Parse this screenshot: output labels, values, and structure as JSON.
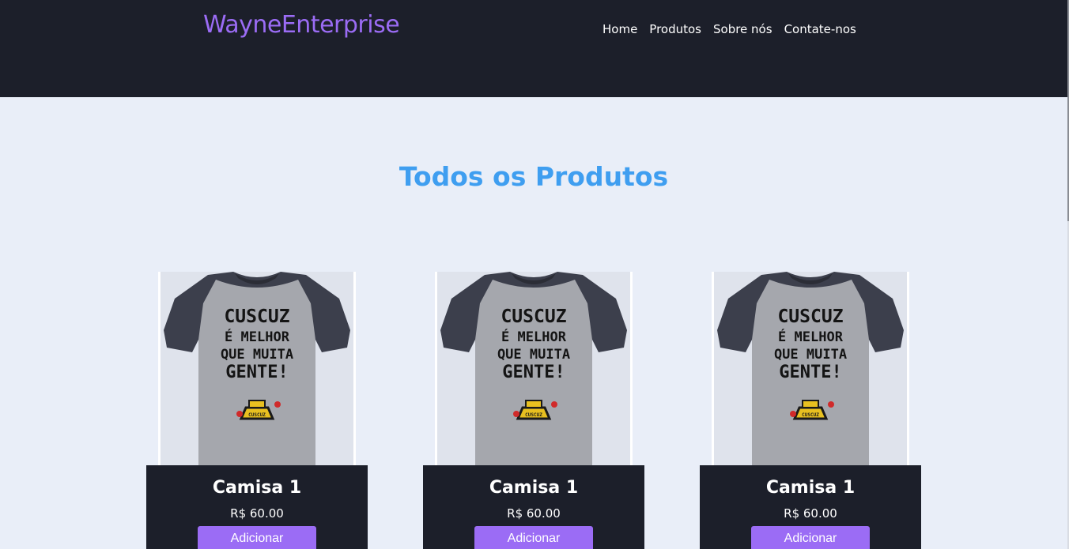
{
  "brand": {
    "logo_text": "WayneEnterprise"
  },
  "nav": {
    "items": [
      {
        "label": "Home"
      },
      {
        "label": "Produtos"
      },
      {
        "label": "Sobre nós"
      },
      {
        "label": "Contate-nos"
      }
    ]
  },
  "main": {
    "title": "Todos os Produtos"
  },
  "products": [
    {
      "name": "Camisa 1",
      "price": "R$ 60.00",
      "button": "Adicionar",
      "shirt_text": [
        "CUSCUZ",
        "É MELHOR",
        "QUE MUITA",
        "GENTE!"
      ],
      "pot_label": "CUSCUZ"
    },
    {
      "name": "Camisa 1",
      "price": "R$ 60.00",
      "button": "Adicionar",
      "shirt_text": [
        "CUSCUZ",
        "É MELHOR",
        "QUE MUITA",
        "GENTE!"
      ],
      "pot_label": "CUSCUZ"
    },
    {
      "name": "Camisa 1",
      "price": "R$ 60.00",
      "button": "Adicionar",
      "shirt_text": [
        "CUSCUZ",
        "É MELHOR",
        "QUE MUITA",
        "GENTE!"
      ],
      "pot_label": "CUSCUZ"
    }
  ],
  "colors": {
    "header_bg": "#1c1f2a",
    "page_bg": "#e9eef8",
    "brand": "#9b6cf5",
    "title": "#3f9ef0",
    "button": "#9b6cf5"
  }
}
